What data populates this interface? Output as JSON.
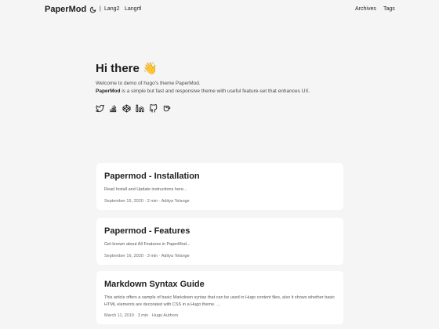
{
  "header": {
    "logo": "PaperMod",
    "languages": [
      "Lang2",
      "Langrtl"
    ],
    "separator": "|",
    "nav": [
      "Archives",
      "Tags"
    ]
  },
  "hero": {
    "title": "Hi there 👋",
    "line1": "Welcome to demo of hugo's theme PaperMod.",
    "line2_bold": "PaperMod",
    "line2_rest": " is a simple but fast and responsive theme with useful feature-set that enhances UX.",
    "social_icons": [
      "twitter-icon",
      "stackoverflow-icon",
      "codepen-icon",
      "linkedin-icon",
      "github-icon",
      "kofi-icon"
    ]
  },
  "posts": [
    {
      "title": "Papermod - Installation",
      "summary": "Read Install and Update instructions here...",
      "meta": "September 15, 2020 · 2 min · Aditya Telange"
    },
    {
      "title": "Papermod - Features",
      "summary": "Get known about All Features in PaperMod...",
      "meta": "September 16, 2020 · 3 min · Aditya Telange"
    },
    {
      "title": "Markdown Syntax Guide",
      "summary": "This article offers a sample of basic Markdown syntax that can be used in Hugo content files, also it shows whether basic HTML elements are decorated with CSS in a Hugo theme. ...",
      "meta": "March 11, 2019 · 3 min · Hugo Authors"
    }
  ],
  "colors": {
    "background": "#f5f5f5",
    "card": "#ffffff",
    "text": "#1e1e1e"
  }
}
